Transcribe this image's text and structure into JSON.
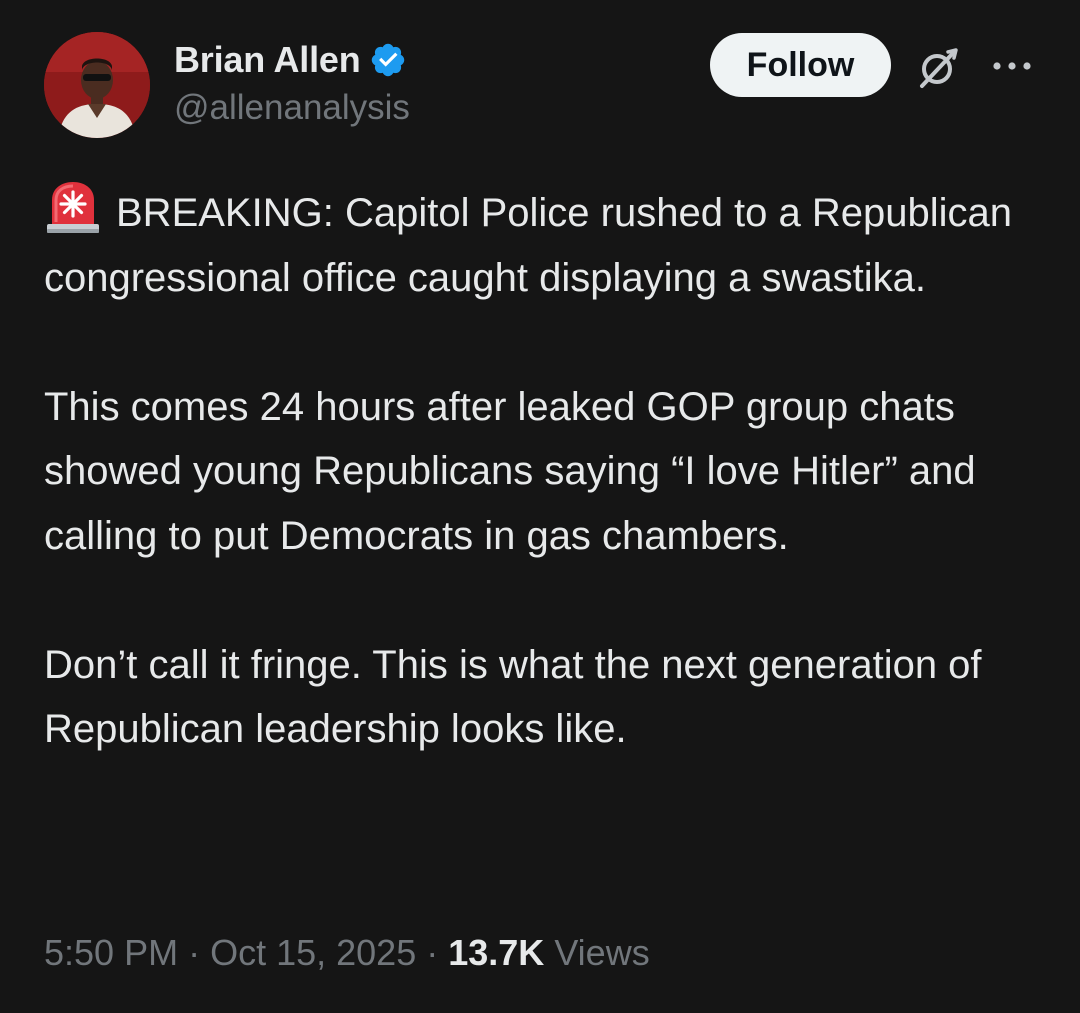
{
  "author": {
    "display_name": "Brian Allen",
    "handle": "@allenanalysis",
    "verified": true,
    "avatar_icon": "profile-photo"
  },
  "actions": {
    "follow_label": "Follow",
    "grok_icon": "grok-icon",
    "more_icon": "more-options-icon"
  },
  "post": {
    "siren_icon": "police-siren-emoji",
    "paragraphs": [
      "BREAKING: Capitol Police rushed to a Republican congressional office caught displaying a swastika.",
      "This comes 24 hours after leaked GOP group chats showed young Republicans saying “I love Hitler” and calling to put Democrats in gas chambers.",
      "Don’t call it fringe. This is what the next generation of Republican leadership looks like."
    ]
  },
  "meta": {
    "time": "5:50 PM",
    "separator": " · ",
    "date": "Oct 15, 2025",
    "views_count": "13.7K",
    "views_label": "Views"
  },
  "colors": {
    "background": "#151515",
    "text_primary": "#e7e9ea",
    "text_secondary": "#71767b",
    "verified_blue": "#1d9bf0",
    "follow_bg": "#eff3f4"
  }
}
